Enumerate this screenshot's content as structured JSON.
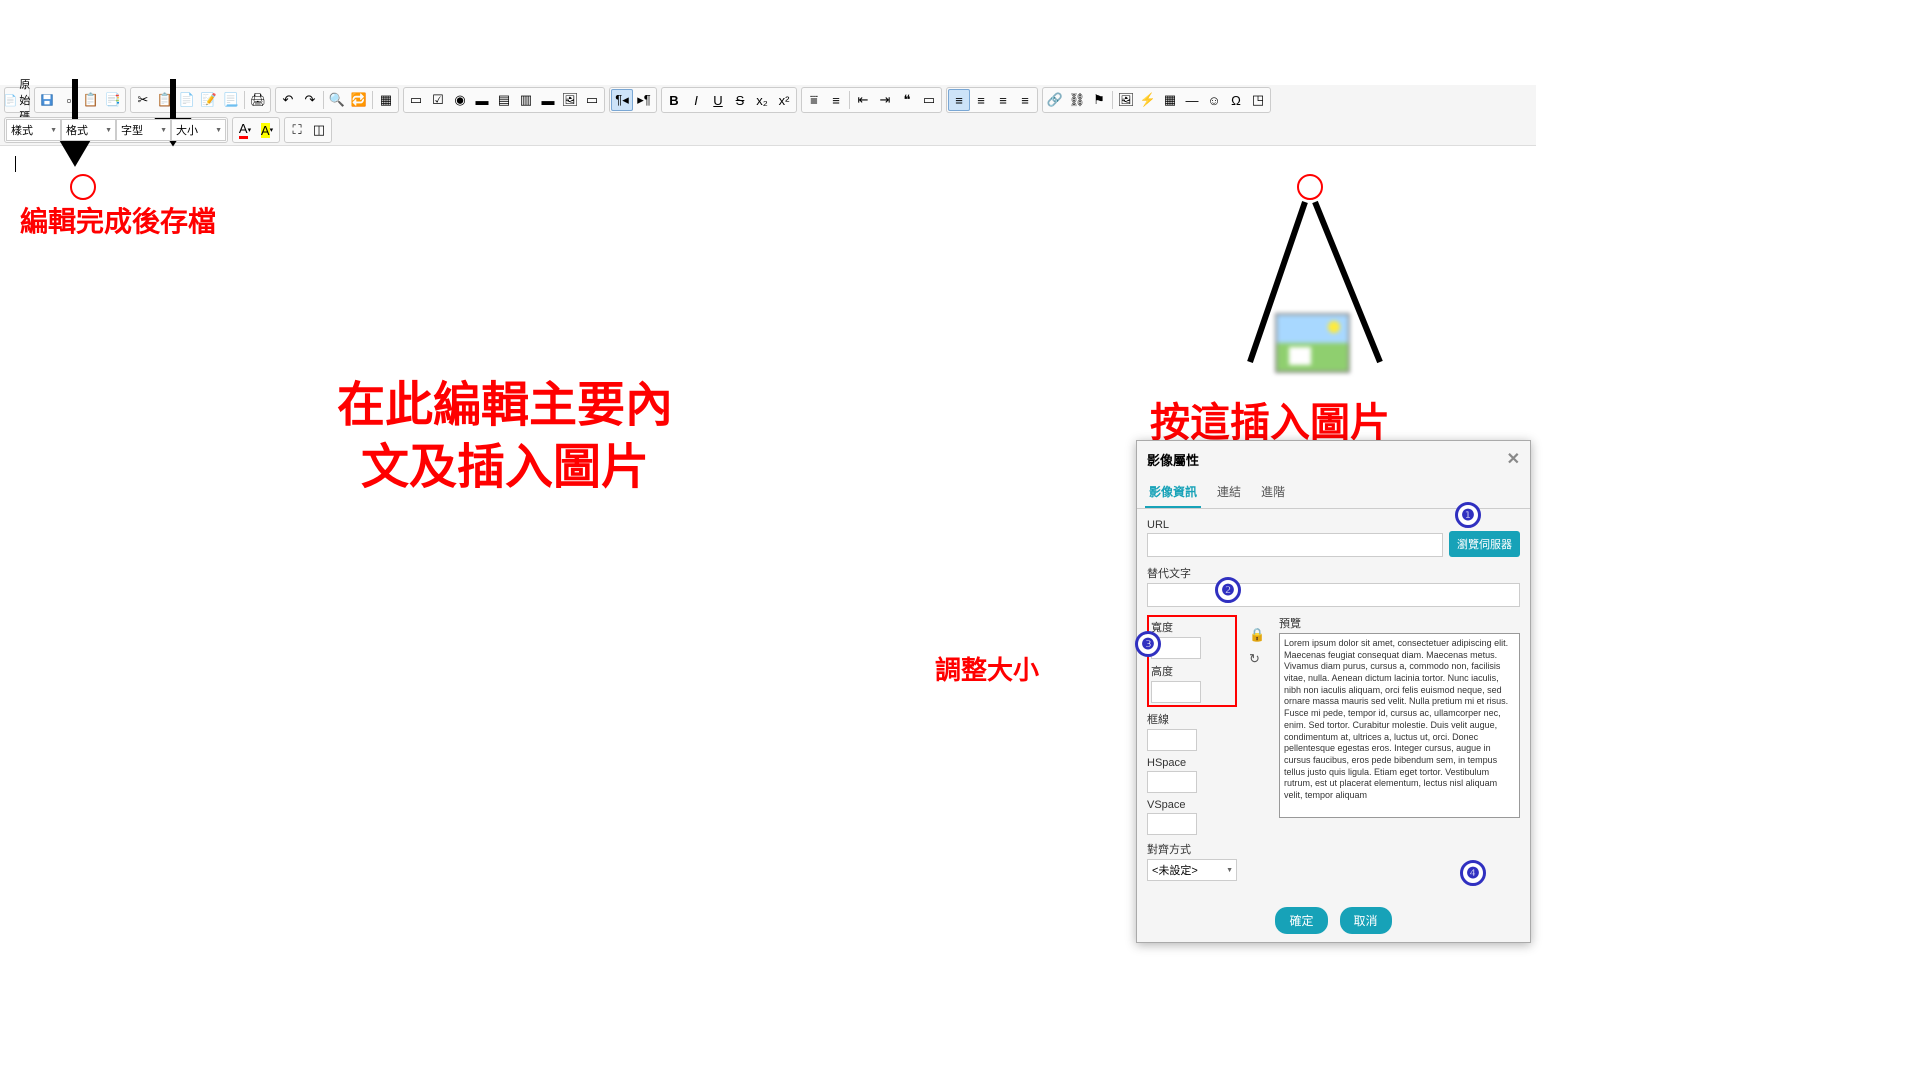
{
  "toolbar": {
    "source_label": "原始碼",
    "styles_label": "樣式",
    "format_label": "格式",
    "font_label": "字型",
    "size_label": "大小"
  },
  "annotations": {
    "save_note": "編輯完成後存檔",
    "main_note_line1": "在此編輯主要內",
    "main_note_line2": "文及插入圖片",
    "insert_image_note": "按這插入圖片",
    "resize_note": "調整大小"
  },
  "dialog": {
    "title": "影像屬性",
    "tabs": {
      "info": "影像資訊",
      "link": "連結",
      "advanced": "進階"
    },
    "url_label": "URL",
    "browse_btn": "瀏覽伺服器",
    "alt_label": "替代文字",
    "width_label": "寬度",
    "height_label": "高度",
    "border_label": "框線",
    "hspace_label": "HSpace",
    "vspace_label": "VSpace",
    "align_label": "對齊方式",
    "align_value": "<未設定>",
    "preview_label": "預覽",
    "preview_text": "Lorem ipsum dolor sit amet, consectetuer adipiscing elit. Maecenas feugiat consequat diam. Maecenas metus. Vivamus diam purus, cursus a, commodo non, facilisis vitae, nulla. Aenean dictum lacinia tortor. Nunc iaculis, nibh non iaculis aliquam, orci felis euismod neque, sed ornare massa mauris sed velit. Nulla pretium mi et risus. Fusce mi pede, tempor id, cursus ac, ullamcorper nec, enim. Sed tortor. Curabitur molestie. Duis velit augue, condimentum at, ultrices a, luctus ut, orci. Donec pellentesque egestas eros. Integer cursus, augue in cursus faucibus, eros pede bibendum sem, in tempus tellus justo quis ligula. Etiam eget tortor. Vestibulum rutrum, est ut placerat elementum, lectus nisl aliquam velit, tempor aliquam",
    "ok_btn": "確定",
    "cancel_btn": "取消"
  }
}
